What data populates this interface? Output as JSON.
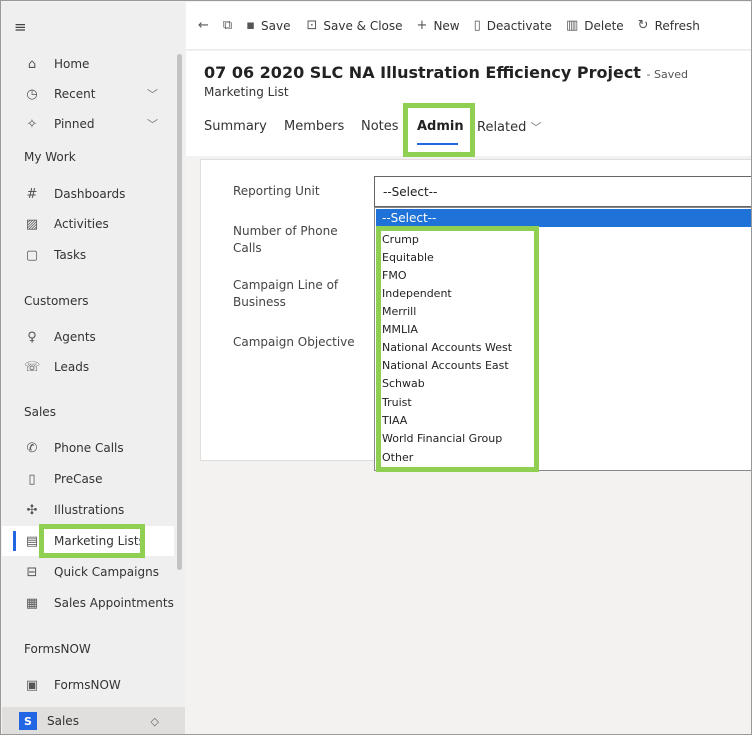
{
  "sidebar": {
    "items": [
      {
        "label": "Home",
        "icon": "home-icon",
        "glyph": "⌂"
      },
      {
        "label": "Recent",
        "icon": "clock-icon",
        "glyph": "◷",
        "chevron": "﹀"
      },
      {
        "label": "Pinned",
        "icon": "pin-icon",
        "glyph": "✧",
        "chevron": "﹀"
      },
      {
        "label": "Dashboards",
        "icon": "dashboard-icon",
        "glyph": "#"
      },
      {
        "label": "Activities",
        "icon": "clipboard-icon",
        "glyph": "▨"
      },
      {
        "label": "Tasks",
        "icon": "task-icon",
        "glyph": "▢"
      },
      {
        "label": "Agents",
        "icon": "person-icon",
        "glyph": "♀"
      },
      {
        "label": "Leads",
        "icon": "phone-person-icon",
        "glyph": "☏"
      },
      {
        "label": "Phone Calls",
        "icon": "phone-icon",
        "glyph": "✆"
      },
      {
        "label": "PreCase",
        "icon": "document-icon",
        "glyph": "▯"
      },
      {
        "label": "Illustrations",
        "icon": "puzzle-icon",
        "glyph": "✣"
      },
      {
        "label": "Marketing Lists",
        "icon": "list-icon",
        "glyph": "▤"
      },
      {
        "label": "Quick Campaigns",
        "icon": "campaign-icon",
        "glyph": "⊟"
      },
      {
        "label": "Sales Appointments",
        "icon": "calendar-icon",
        "glyph": "▦"
      },
      {
        "label": "FormsNOW",
        "icon": "form-icon",
        "glyph": "▣"
      }
    ],
    "groups": [
      "My Work",
      "Customers",
      "Sales",
      "FormsNOW"
    ],
    "area": {
      "badge": "S",
      "label": "Sales"
    }
  },
  "commandbar": {
    "back": "←",
    "popout": "⧉",
    "save": "Save",
    "save_close": "Save & Close",
    "new": "New",
    "deactivate": "Deactivate",
    "delete": "Delete",
    "refresh": "Refresh"
  },
  "header": {
    "title": "07 06 2020 SLC NA Illustration Efficiency Project",
    "status": "- Saved",
    "entity": "Marketing List",
    "tabs": [
      "Summary",
      "Members",
      "Notes",
      "Admin",
      "Related"
    ],
    "active_tab": "Admin"
  },
  "form": {
    "labels": [
      "Reporting Unit",
      "Number of Phone Calls",
      "Campaign Line of Business",
      "Campaign Objective"
    ],
    "reporting_unit_value": "--Select--"
  },
  "dropdown": {
    "selected": "--Select--",
    "options": [
      "Crump",
      "Equitable",
      "FMO",
      "Independent",
      "Merrill",
      "MMLIA",
      "National Accounts West",
      "National Accounts East",
      "Schwab",
      "Truist",
      "TIAA",
      "World Financial Group",
      "Other"
    ]
  },
  "colors": {
    "accent": "#2266e3",
    "highlight": "#8fcf52",
    "selection": "#1e72d8"
  }
}
